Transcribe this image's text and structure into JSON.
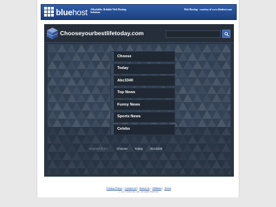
{
  "banner": {
    "brand_bold": "blue",
    "brand_rest": "host",
    "tagline": "Affordable, Reliable Web Hosting Solutions",
    "right_text": "Web Hosting - courtesy of www.bluehost.com"
  },
  "site": {
    "title": "Chooseyourbestlifetoday.com",
    "search_placeholder": ""
  },
  "links": [
    {
      "label": "Choose"
    },
    {
      "label": "Today"
    },
    {
      "label": "Abc3340"
    },
    {
      "label": "Top News"
    },
    {
      "label": "Funny News"
    },
    {
      "label": "Sports News"
    },
    {
      "label": "Celebs"
    }
  ],
  "related": {
    "label": "Related links:",
    "items": [
      "Choose",
      "Today",
      "Abc3340"
    ]
  },
  "footer": {
    "links": [
      "Privacy Policy",
      "Contact Us",
      "About Us",
      "Affiliates",
      "Terms"
    ],
    "copyright": "© 2012 Bluehost.com. All rights reserved."
  },
  "colors": {
    "banner_blue": "#2f5ea8",
    "panel_dark": "#2b3542",
    "panel_body": "#37465a",
    "link_bg": "#1f2833",
    "search_button": "#3b63a8"
  }
}
